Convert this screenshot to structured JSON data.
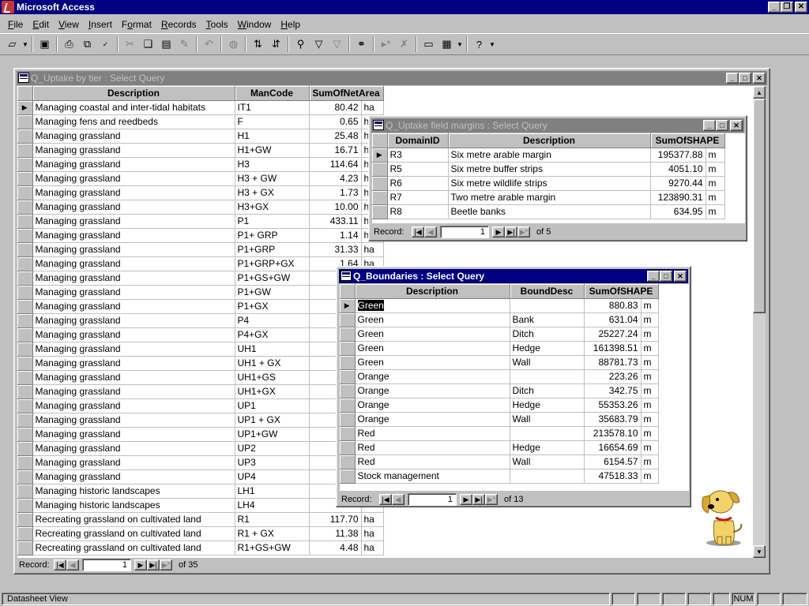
{
  "app": {
    "title": "Microsoft Access"
  },
  "menu": [
    "File",
    "Edit",
    "View",
    "Insert",
    "Format",
    "Records",
    "Tools",
    "Window",
    "Help"
  ],
  "menu_accel": [
    "F",
    "E",
    "V",
    "I",
    "o",
    "R",
    "T",
    "W",
    "H"
  ],
  "toolbar": {
    "icons": [
      "view-icon",
      "dropdown-icon",
      "save-icon",
      "print-icon",
      "print-preview-icon",
      "spelling-icon",
      "cut-icon",
      "copy-icon",
      "paste-icon",
      "format-painter-icon",
      "undo-icon",
      "web-icon",
      "sort-ascending-icon",
      "sort-descending-icon",
      "filter-by-selection-icon",
      "filter-by-form-icon",
      "apply-filter-icon",
      "find-icon",
      "new-record-icon",
      "delete-record-icon",
      "database-window-icon",
      "new-object-icon",
      "dropdown-icon",
      "help-icon"
    ]
  },
  "status": {
    "text": "Datasheet View",
    "num": "NUM"
  },
  "win1": {
    "title": "Q_Uptake by tier : Select Query",
    "columns": [
      "Description",
      "ManCode",
      "SumOfNetArea"
    ],
    "rows": [
      [
        "Managing coastal and inter-tidal habitats",
        "IT1",
        "80.42",
        "ha"
      ],
      [
        "Managing fens and reedbeds",
        "F",
        "0.65",
        "ha"
      ],
      [
        "Managing grassland",
        "H1",
        "25.48",
        "ha"
      ],
      [
        "Managing grassland",
        "H1+GW",
        "16.71",
        "ha"
      ],
      [
        "Managing grassland",
        "H3",
        "114.64",
        "ha"
      ],
      [
        "Managing grassland",
        "H3 + GW",
        "4.23",
        "ha"
      ],
      [
        "Managing grassland",
        "H3 + GX",
        "1.73",
        "ha"
      ],
      [
        "Managing grassland",
        "H3+GX",
        "10.00",
        "ha"
      ],
      [
        "Managing grassland",
        "P1",
        "433.11",
        "ha"
      ],
      [
        "Managing grassland",
        "P1+ GRP",
        "1.14",
        "ha"
      ],
      [
        "Managing grassland",
        "P1+GRP",
        "31.33",
        "ha"
      ],
      [
        "Managing grassland",
        "P1+GRP+GX",
        "1.64",
        "ha"
      ],
      [
        "Managing grassland",
        "P1+GS+GW",
        "",
        ""
      ],
      [
        "Managing grassland",
        "P1+GW",
        "",
        ""
      ],
      [
        "Managing grassland",
        "P1+GX",
        "",
        ""
      ],
      [
        "Managing grassland",
        "P4",
        "",
        ""
      ],
      [
        "Managing grassland",
        "P4+GX",
        "",
        ""
      ],
      [
        "Managing grassland",
        "UH1",
        "1",
        ""
      ],
      [
        "Managing grassland",
        "UH1 + GX",
        "",
        ""
      ],
      [
        "Managing grassland",
        "UH1+GS",
        "",
        ""
      ],
      [
        "Managing grassland",
        "UH1+GX",
        "",
        ""
      ],
      [
        "Managing grassland",
        "UP1",
        "3(",
        ""
      ],
      [
        "Managing grassland",
        "UP1 + GX",
        "",
        ""
      ],
      [
        "Managing grassland",
        "UP1+GW",
        "",
        ""
      ],
      [
        "Managing grassland",
        "UP2",
        "1!",
        ""
      ],
      [
        "Managing grassland",
        "UP3",
        "2",
        ""
      ],
      [
        "Managing grassland",
        "UP4",
        "",
        ""
      ],
      [
        "Managing historic landscapes",
        "LH1",
        "",
        ""
      ],
      [
        "Managing historic landscapes",
        "LH4",
        "",
        ""
      ],
      [
        "Recreating grassland on cultivated land",
        "R1",
        "117.70",
        "ha"
      ],
      [
        "Recreating grassland on cultivated land",
        "R1 + GX",
        "11.38",
        "ha"
      ],
      [
        "Recreating grassland on cultivated land",
        "R1+GS+GW",
        "4.48",
        "ha"
      ]
    ],
    "nav": {
      "label": "Record:",
      "current": "1",
      "of": "of 35"
    }
  },
  "win2": {
    "title": "Q_Uptake field margins : Select Query",
    "columns": [
      "DomainID",
      "Description",
      "SumOfSHAPE"
    ],
    "rows": [
      [
        "R3",
        "Six metre arable margin",
        "195377.88",
        "m"
      ],
      [
        "R5",
        "Six metre buffer strips",
        "4051.10",
        "m"
      ],
      [
        "R6",
        "Six metre wildlife strips",
        "9270.44",
        "m"
      ],
      [
        "R7",
        "Two metre arable margin",
        "123890.31",
        "m"
      ],
      [
        "R8",
        "Beetle banks",
        "634.95",
        "m"
      ]
    ],
    "nav": {
      "label": "Record:",
      "current": "1",
      "of": "of 5"
    }
  },
  "win3": {
    "title": "Q_Boundaries : Select Query",
    "columns": [
      "Description",
      "BoundDesc",
      "SumOfSHAPE"
    ],
    "rows": [
      [
        "Green",
        "",
        "880.83",
        "m"
      ],
      [
        "Green",
        "Bank",
        "631.04",
        "m"
      ],
      [
        "Green",
        "Ditch",
        "25227.24",
        "m"
      ],
      [
        "Green",
        "Hedge",
        "161398.51",
        "m"
      ],
      [
        "Green",
        "Wall",
        "88781.73",
        "m"
      ],
      [
        "Orange",
        "",
        "223.26",
        "m"
      ],
      [
        "Orange",
        "Ditch",
        "342.75",
        "m"
      ],
      [
        "Orange",
        "Hedge",
        "55353.26",
        "m"
      ],
      [
        "Orange",
        "Wall",
        "35683.79",
        "m"
      ],
      [
        "Red",
        "",
        "213578.10",
        "m"
      ],
      [
        "Red",
        "Hedge",
        "16654.69",
        "m"
      ],
      [
        "Red",
        "Wall",
        "6154.57",
        "m"
      ],
      [
        "Stock management",
        "",
        "47518.33",
        "m"
      ]
    ],
    "nav": {
      "label": "Record:",
      "current": "1",
      "of": "of 13"
    }
  },
  "assistant": {
    "name": "office-assistant-dog"
  }
}
